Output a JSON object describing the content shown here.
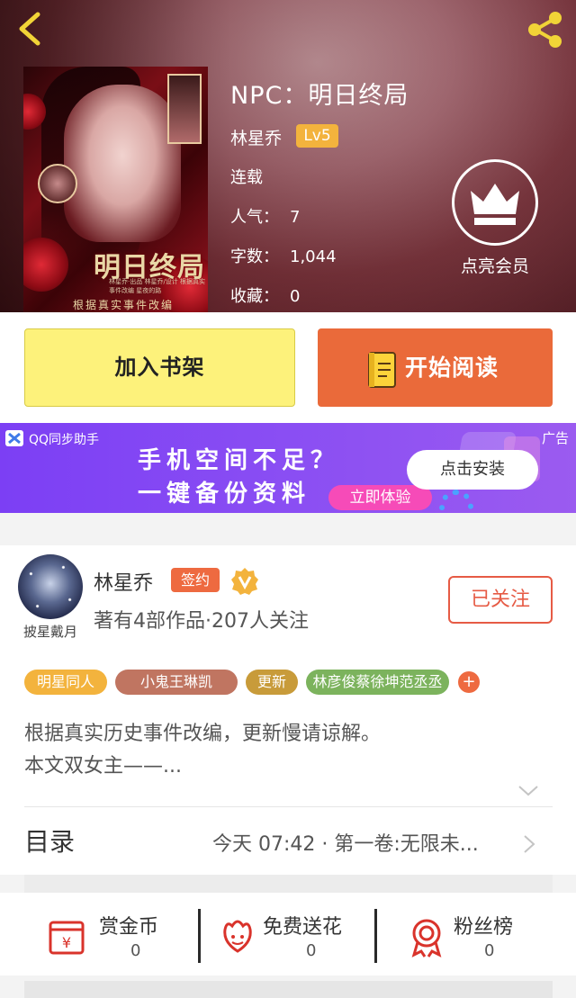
{
  "book": {
    "title": "NPC：明日终局",
    "author": "林星乔",
    "level": "Lv5",
    "status": "连载",
    "popularity_label": "人气：",
    "popularity": "7",
    "wordcount_label": "字数：",
    "wordcount": "1,044",
    "favorites_label": "收藏：",
    "favorites": "0",
    "vip_label": "点亮会员",
    "cover": {
      "title": "明日终局",
      "subtitle": "根据真实事件改编",
      "fine_print": "林星乔·出品 林星乔/设计 根据真实事件改编 星夜的路"
    }
  },
  "actions": {
    "add_shelf": "加入书架",
    "start_read": "开始阅读"
  },
  "ad": {
    "source": "QQ同步助手",
    "label": "广告",
    "headline1": "手机空间不足？",
    "headline2": "一键备份资料",
    "try_label": "立即体验",
    "install_label": "点击安装",
    "colors": {
      "bg": "#8a4ef3",
      "try": "#f64bb8"
    }
  },
  "author_card": {
    "name": "林星乔",
    "sign_badge": "签约",
    "avatar_caption": "披星戴月",
    "stats": "著有4部作品·207人关注",
    "follow_label": "已关注"
  },
  "tags": [
    {
      "label": "明星同人",
      "color": "#f3b33d"
    },
    {
      "label": "小鬼王琳凯",
      "color": "#c07561"
    },
    {
      "label": "更新",
      "color": "#c89b3a"
    },
    {
      "label": "林彦俊蔡徐坤范丞丞",
      "color": "#7cb35d"
    }
  ],
  "tag_more": "+",
  "description": {
    "line1": "根据真实历史事件改编，更新慢请谅解。",
    "line2": "本文双女主——..."
  },
  "toc": {
    "title": "目录",
    "latest": "今天 07:42 · 第一卷:无限未..."
  },
  "rewards": [
    {
      "label": "赏金币",
      "count": "0",
      "icon": "money-bag-icon"
    },
    {
      "label": "免费送花",
      "count": "0",
      "icon": "flower-icon"
    },
    {
      "label": "粉丝榜",
      "count": "0",
      "icon": "medal-icon"
    }
  ],
  "colors": {
    "accent": "#ea6a3a",
    "shelf": "#fdf27b",
    "icon_red": "#d9332b"
  }
}
